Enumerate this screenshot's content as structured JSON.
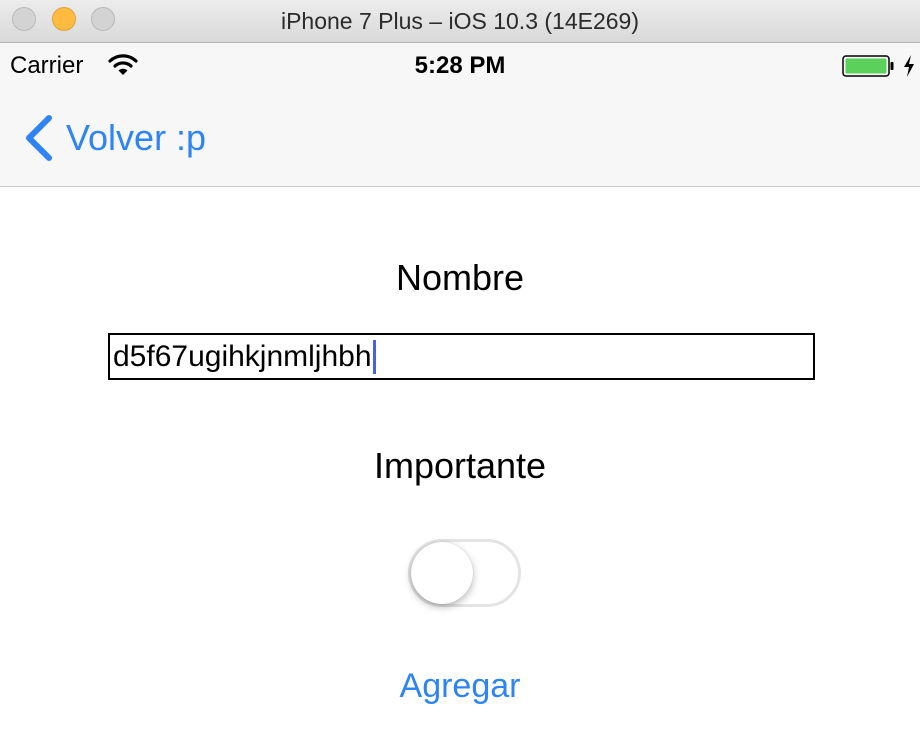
{
  "window": {
    "title": "iPhone 7 Plus – iOS 10.3 (14E269)"
  },
  "statusbar": {
    "carrier": "Carrier",
    "time": "5:28 PM",
    "battery_color": "#5bd05b"
  },
  "navbar": {
    "back_label": "Volver :p"
  },
  "form": {
    "name_label": "Nombre",
    "name_value": "d5f67ugihkjnmljhbh",
    "important_label": "Importante",
    "important_on": false,
    "add_label": "Agregar"
  },
  "colors": {
    "accent": "#2f84f4",
    "caret": "#4561e6"
  }
}
